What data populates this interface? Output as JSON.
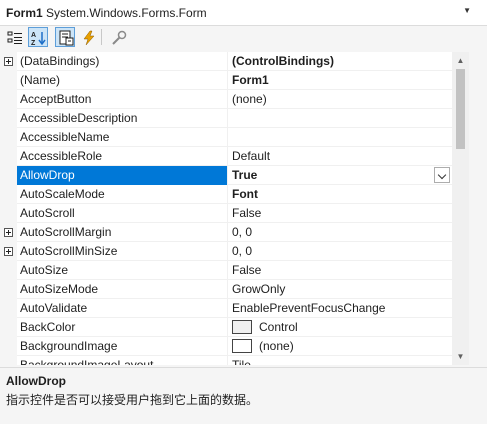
{
  "selector": {
    "name": "Form1",
    "type": "System.Windows.Forms.Form"
  },
  "toolbar": {
    "buttons": [
      {
        "name": "categorized-icon"
      },
      {
        "name": "alphabetical-icon"
      },
      {
        "name": "properties-icon"
      },
      {
        "name": "events-icon"
      },
      {
        "name": "property-pages-icon"
      }
    ]
  },
  "properties": [
    {
      "name": "(DataBindings)",
      "value": "(ControlBindings)",
      "expandable": true,
      "bold": true
    },
    {
      "name": "(Name)",
      "value": "Form1",
      "bold": true
    },
    {
      "name": "AcceptButton",
      "value": "(none)"
    },
    {
      "name": "AccessibleDescription",
      "value": ""
    },
    {
      "name": "AccessibleName",
      "value": ""
    },
    {
      "name": "AccessibleRole",
      "value": "Default"
    },
    {
      "name": "AllowDrop",
      "value": "True",
      "bold": true,
      "selected": true,
      "dropdown": true
    },
    {
      "name": "AutoScaleMode",
      "value": "Font",
      "bold": true
    },
    {
      "name": "AutoScroll",
      "value": "False"
    },
    {
      "name": "AutoScrollMargin",
      "value": "0, 0",
      "expandable": true
    },
    {
      "name": "AutoScrollMinSize",
      "value": "0, 0",
      "expandable": true
    },
    {
      "name": "AutoSize",
      "value": "False"
    },
    {
      "name": "AutoSizeMode",
      "value": "GrowOnly"
    },
    {
      "name": "AutoValidate",
      "value": "EnablePreventFocusChange"
    },
    {
      "name": "BackColor",
      "value": "Control",
      "swatch": "#f0f0f0"
    },
    {
      "name": "BackgroundImage",
      "value": "(none)",
      "swatch": "#ffffff"
    },
    {
      "name": "BackgroundImageLayout",
      "value": "Tile"
    }
  ],
  "description": {
    "title": "AllowDrop",
    "text": "指示控件是否可以接受用户拖到它上面的数据。"
  }
}
